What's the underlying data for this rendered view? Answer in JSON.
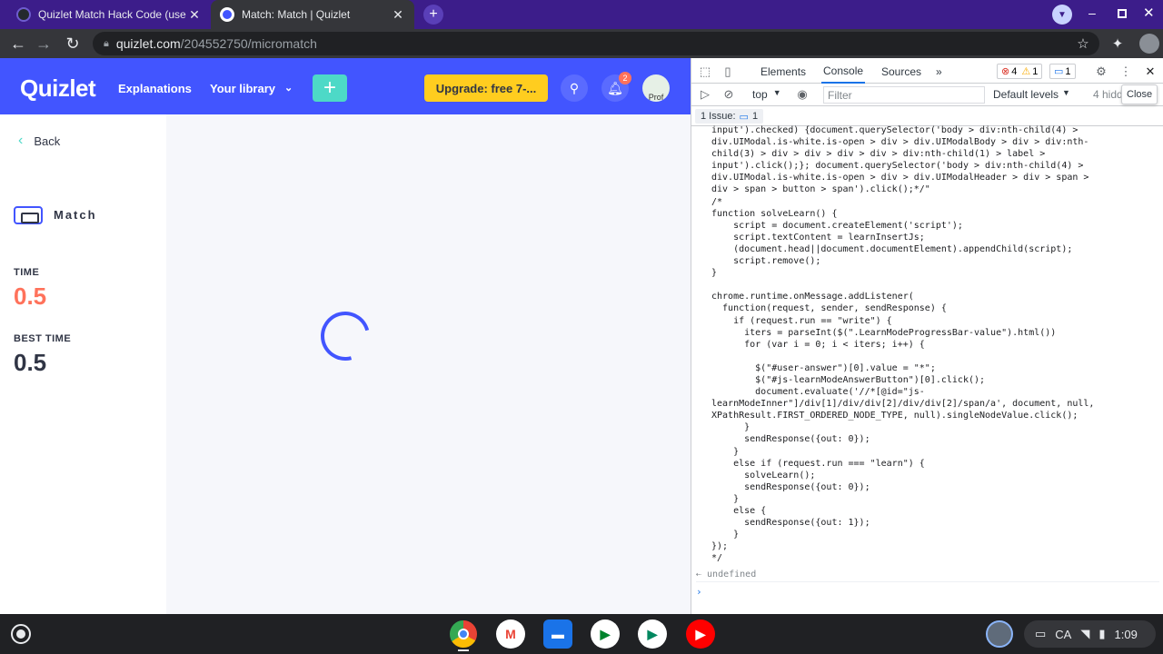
{
  "browser": {
    "tabs": [
      {
        "title": "Quizlet Match Hack Code (use ta",
        "close": "✕"
      },
      {
        "title": "Match: Match | Quizlet",
        "close": "✕"
      }
    ],
    "new_tab": "+",
    "url_host": "quizlet.com",
    "url_path": "/204552750/micromatch"
  },
  "quizlet": {
    "logo": "Quizlet",
    "nav": [
      "Explanations",
      "Your library"
    ],
    "plus": "+",
    "upgrade": "Upgrade: free 7-...",
    "notifications_count": "2",
    "avatar_text": "Prof",
    "back": "Back",
    "mode": "Match",
    "time_label": "TIME",
    "time_value": "0.5",
    "best_label": "BEST TIME",
    "best_value": "0.5",
    "colors": {
      "brand": "#4255ff",
      "time": "#ff725b",
      "upgrade": "#ffcd1f",
      "accent": "#4dd9c7"
    }
  },
  "devtools": {
    "tabs": [
      "Elements",
      "Console",
      "Sources"
    ],
    "more": "»",
    "errors": "4",
    "warnings": "1",
    "messages": "1",
    "context": "top",
    "filter_placeholder": "Filter",
    "levels": "Default levels",
    "hidden": "4 hidd",
    "close_tooltip": "Close",
    "issues_label": "1 Issue:",
    "issues_count": "1",
    "code_lines": [
      "input').checked) {document.querySelector('body > div:nth-child(4) >",
      "div.UIModal.is-white.is-open > div > div.UIModalBody > div > div:nth-",
      "child(3) > div > div > div > div > div:nth-child(1) > label >",
      "input').click();}; document.querySelector('body > div:nth-child(4) >",
      "div.UIModal.is-white.is-open > div > div.UIModalHeader > div > span >",
      "div > span > button > span').click();*/\"",
      "/*",
      "function solveLearn() {",
      "    script = document.createElement('script');",
      "    script.textContent = learnInsertJs;",
      "    (document.head||document.documentElement).appendChild(script);",
      "    script.remove();",
      "}",
      "",
      "chrome.runtime.onMessage.addListener(",
      "  function(request, sender, sendResponse) {",
      "    if (request.run == \"write\") {",
      "      iters = parseInt($(\".LearnModeProgressBar-value\").html())",
      "      for (var i = 0; i < iters; i++) {",
      "",
      "        $(\"#user-answer\")[0].value = \"*\";",
      "        $(\"#js-learnModeAnswerButton\")[0].click();",
      "        document.evaluate('//*[@id=\"js-",
      "learnModeInner\"]/div[1]/div/div[2]/div/div[2]/span/a', document, null,",
      "XPathResult.FIRST_ORDERED_NODE_TYPE, null).singleNodeValue.click();",
      "      }",
      "      sendResponse({out: 0});",
      "    }",
      "    else if (request.run === \"learn\") {",
      "      solveLearn();",
      "      sendResponse({out: 0});",
      "    }",
      "    else {",
      "      sendResponse({out: 1});",
      "    }",
      "});",
      "*/"
    ],
    "result": "undefined",
    "prompt": "›"
  },
  "shelf": {
    "apps": [
      "chrome",
      "gmail",
      "files",
      "meet",
      "play-store",
      "youtube"
    ],
    "ime": "CA",
    "time": "1:09"
  }
}
